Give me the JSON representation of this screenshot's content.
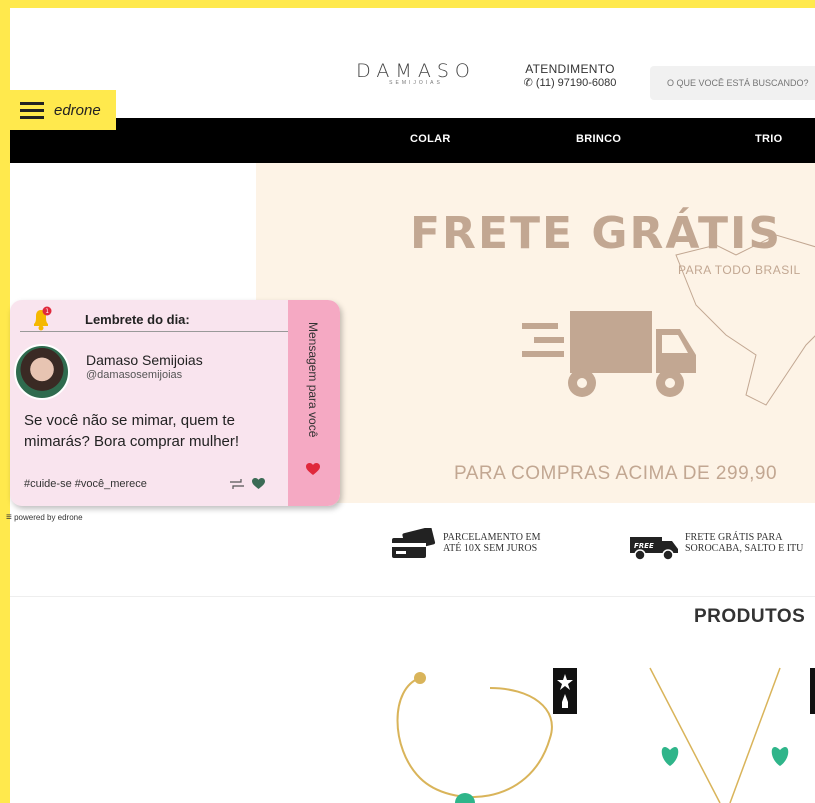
{
  "header": {
    "logo_text": "DAMASO",
    "logo_subtitle": "SEMIJOIAS",
    "atendimento_label": "ATENDIMENTO",
    "phone": "(11) 97190-6080",
    "search_placeholder": "O QUE VOCÊ ESTÁ BUSCANDO?"
  },
  "nav": {
    "items": [
      "COLAR",
      "BRINCO",
      "TRIO"
    ]
  },
  "banner": {
    "title": "FRETE GRÁTIS",
    "subtitle": "PARA TODO BRASIL",
    "footer": "PARA COMPRAS ACIMA DE 299,90"
  },
  "features": [
    {
      "line1": "PARCELAMENTO EM",
      "line2": "ATÉ 10X SEM JUROS"
    },
    {
      "line1": "FRETE GRÁTIS PARA",
      "line2": "SOROCABA, SALTO E ITU"
    }
  ],
  "products_title": "PRODUTOS",
  "edrone": {
    "tab_label": "edrone",
    "card_title": "Lembrete do dia:",
    "account_name": "Damaso Semijoias",
    "account_handle": "@damasosemijoias",
    "message": "Se você não se mimar, quem te mimarás? Bora comprar mulher!",
    "hashtags": "#cuide-se #você_merece",
    "side_label": "Mensagem para você",
    "powered_by": "powered by edrone",
    "notification_count": "1"
  },
  "colors": {
    "edrone_yellow": "#ffe94d",
    "nav_bg": "#000000",
    "banner_bg": "#fdf3e6",
    "banner_text": "#c2a792",
    "card_bg": "#f9e4ee",
    "card_side": "#f5a9c3"
  }
}
